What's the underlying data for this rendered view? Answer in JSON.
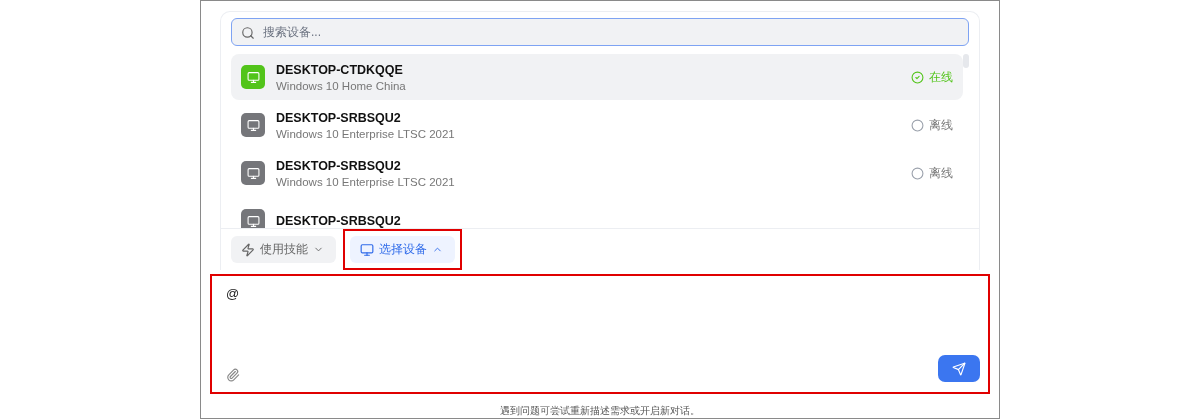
{
  "search": {
    "placeholder": "搜索设备..."
  },
  "devices": [
    {
      "name": "DESKTOP-CTDKQQE",
      "os": "Windows 10 Home China",
      "status": "在线",
      "online": true,
      "selected": true
    },
    {
      "name": "DESKTOP-SRBSQU2",
      "os": "Windows 10 Enterprise LTSC 2021",
      "status": "离线",
      "online": false,
      "selected": false
    },
    {
      "name": "DESKTOP-SRBSQU2",
      "os": "Windows 10 Enterprise LTSC 2021",
      "status": "离线",
      "online": false,
      "selected": false
    },
    {
      "name": "DESKTOP-SRBSQU2",
      "online": false,
      "selected": false
    }
  ],
  "toolbar": [
    {
      "kind": "skill",
      "label": "使用技能",
      "selected": false,
      "highlighted": false
    },
    {
      "kind": "device",
      "label": "选择设备",
      "selected": true,
      "highlighted": true
    }
  ],
  "composer": {
    "value": "@",
    "highlighted": true
  },
  "footer": "遇到问题可尝试重新描述需求或开启新对话。"
}
